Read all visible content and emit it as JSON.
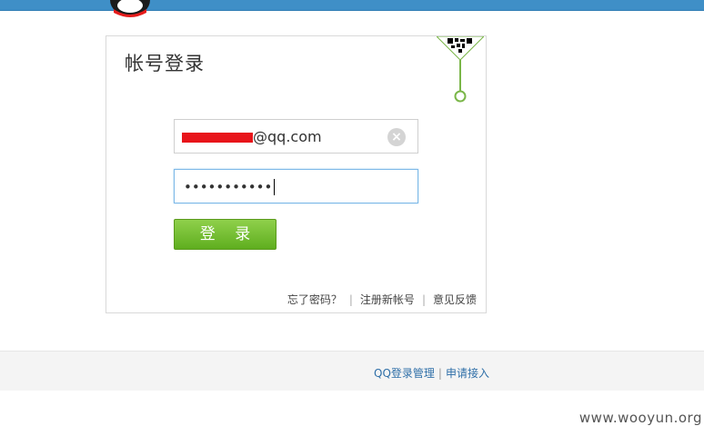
{
  "login": {
    "title": "帐号登录",
    "username_value": "@qq.com",
    "password_value": "•••••••••••",
    "login_button": "登 录",
    "clear_icon": "×"
  },
  "links": {
    "forgot_password": "忘了密码？",
    "register": "注册新帐号",
    "feedback": "意见反馈",
    "separator": "|"
  },
  "footer": {
    "manage": "QQ登录管理",
    "apply": "申请接入",
    "separator": "|"
  },
  "watermark": "www.wooyun.org",
  "colors": {
    "topbar": "#3f8fc7",
    "login_button": "#6cbb2c",
    "qr_accent": "#7ab648",
    "redaction": "#e8141a",
    "link": "#2f6fa8"
  }
}
